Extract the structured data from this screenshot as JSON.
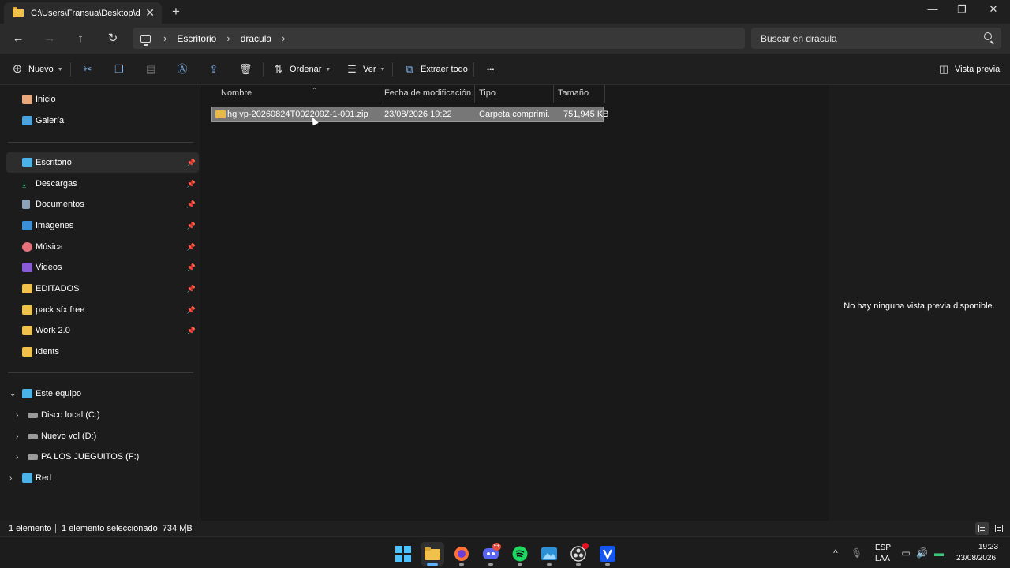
{
  "window": {
    "tab_title": "C:\\Users\\Fransua\\Desktop\\dra",
    "tab_close": "✕",
    "new_tab": "+",
    "minimize": "—",
    "maximize": "❐",
    "close": "✕"
  },
  "nav": {
    "back": "←",
    "forward": "→",
    "up": "↑",
    "refresh": "↻"
  },
  "breadcrumb": [
    "Escritorio",
    "dracula"
  ],
  "search": {
    "placeholder": "Buscar en dracula"
  },
  "toolbar": {
    "new_label": "Nuevo",
    "sort_label": "Ordenar",
    "view_label": "Ver",
    "extract_label": "Extraer todo",
    "more": "•••",
    "preview_label": "Vista previa"
  },
  "sidebar": {
    "home": "Inicio",
    "gallery": "Galería",
    "quick": [
      "Escritorio",
      "Descargas",
      "Documentos",
      "Imágenes",
      "Música",
      "Videos",
      "EDITADOS",
      "pack sfx free",
      "Work 2.0",
      "Idents"
    ],
    "pc": "Este equipo",
    "drives": [
      "Disco local (C:)",
      "Nuevo vol (D:)",
      "PA LOS JUEGUITOS (F:)"
    ],
    "network": "Red"
  },
  "columns": {
    "name": "Nombre",
    "modified": "Fecha de modificación",
    "type": "Tipo",
    "size": "Tamaño"
  },
  "files": [
    {
      "name": "hg vp-20260824T002209Z-1-001.zip",
      "modified": "23/08/2026 19:22",
      "type": "Carpeta comprimi...",
      "size": "751,945 KB"
    }
  ],
  "preview": {
    "message": "No hay ninguna vista previa disponible."
  },
  "status": {
    "count": "1 elemento",
    "selected": "1 elemento seleccionado  734 MB"
  },
  "taskbar": {
    "discord_badge": "9+",
    "lang_top": "ESP",
    "lang_bottom": "LAA",
    "time": "19:23",
    "date": "23/08/2026",
    "chevron": "^"
  },
  "colors": {
    "accent": "#5fb2ff",
    "folder": "#f0c24b",
    "selected_row": "#777777"
  }
}
